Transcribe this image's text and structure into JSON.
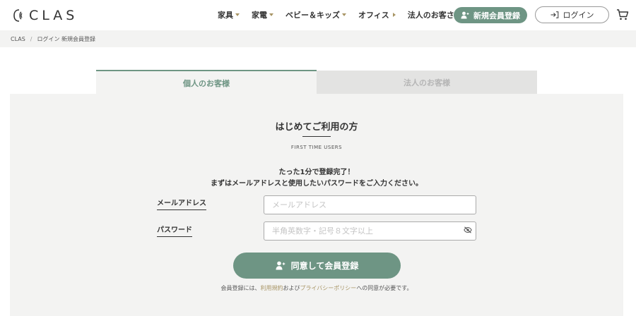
{
  "header": {
    "logo_text": "CLAS",
    "nav": [
      {
        "label": "家具",
        "caret": "down"
      },
      {
        "label": "家電",
        "caret": "down"
      },
      {
        "label": "ベビー＆キッズ",
        "caret": "down"
      },
      {
        "label": "オフィス",
        "caret": "right"
      },
      {
        "label": "法人のお客さまへ",
        "caret": "none"
      }
    ],
    "signup_label": "新規会員登録",
    "login_label": "ログイン"
  },
  "breadcrumb": {
    "items": [
      "CLAS",
      "ログイン 新規会員登録"
    ],
    "separator": "/"
  },
  "tabs": {
    "personal": "個人のお客様",
    "business": "法人のお客様"
  },
  "form": {
    "title": "はじめてご利用の方",
    "subtitle": "FIRST TIME USERS",
    "lead_line1": "たった1分で登録完了！",
    "lead_line2": "まずはメールアドレスと使用したいパスワードをご入力ください。",
    "email_label": "メールアドレス",
    "email_placeholder": "メールアドレス",
    "password_label": "パスワード",
    "password_placeholder": "半角英数字・記号８文字以上",
    "submit_label": "同意して会員登録",
    "note_prefix": "会員登録には、",
    "terms_link": "利用規約",
    "note_middle": "および",
    "privacy_link": "プライバシーポリシー",
    "note_suffix": "への同意が必要です。"
  },
  "colors": {
    "accent": "#6e9584",
    "gold": "#a89565",
    "panel_bg": "#f3f3f2"
  }
}
